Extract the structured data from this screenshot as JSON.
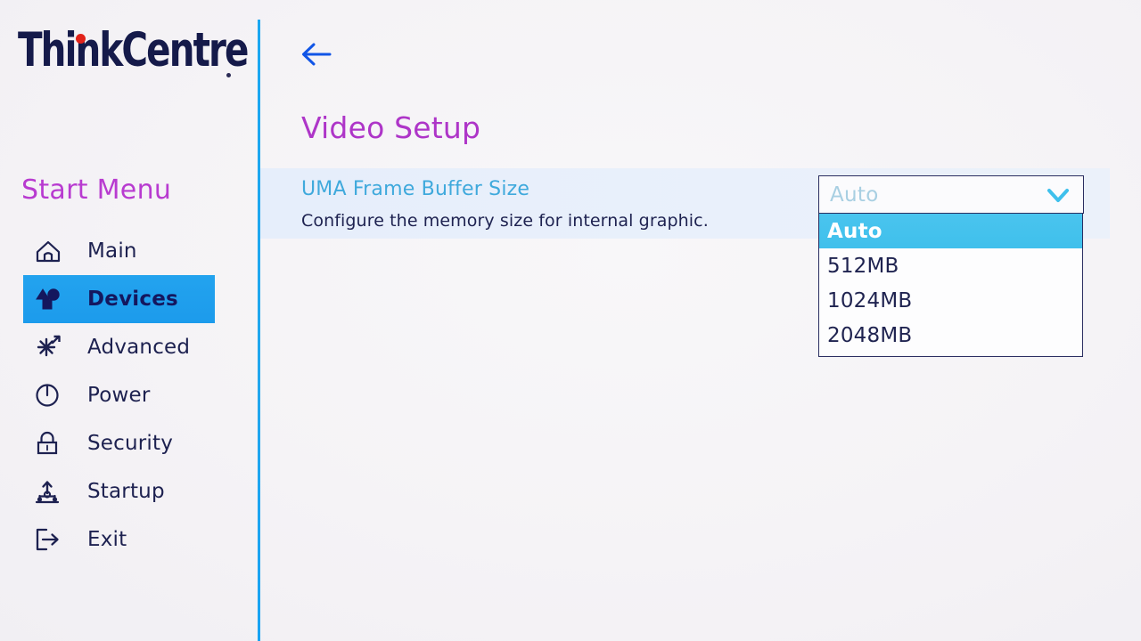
{
  "brand": {
    "logo_text": "ThinkCentre",
    "accent_dot_color": "#E2231A",
    "logo_color": "#151A4A"
  },
  "sidebar": {
    "title": "Start Menu",
    "title_color": "#B83BD0",
    "selected_color": "#1C9BEC",
    "items": [
      {
        "label": "Main",
        "icon": "home-icon",
        "selected": false
      },
      {
        "label": "Devices",
        "icon": "devices-icon",
        "selected": true
      },
      {
        "label": "Advanced",
        "icon": "advanced-icon",
        "selected": false
      },
      {
        "label": "Power",
        "icon": "power-icon",
        "selected": false
      },
      {
        "label": "Security",
        "icon": "lock-icon",
        "selected": false
      },
      {
        "label": "Startup",
        "icon": "startup-icon",
        "selected": false
      },
      {
        "label": "Exit",
        "icon": "exit-icon",
        "selected": false
      }
    ]
  },
  "main": {
    "back_icon": "back-arrow-icon",
    "title": "Video Setup",
    "title_color": "#AE35C8",
    "setting": {
      "label": "UMA Frame Buffer Size",
      "label_color": "#3FA9DC",
      "description": "Configure the memory size for internal graphic."
    },
    "dropdown": {
      "selected_value": "Auto",
      "chevron_icon": "chevron-down-icon",
      "expanded": true,
      "highlight_color": "#3FC0EC",
      "options": [
        {
          "label": "Auto",
          "highlighted": true
        },
        {
          "label": "512MB",
          "highlighted": false
        },
        {
          "label": "1024MB",
          "highlighted": false
        },
        {
          "label": "2048MB",
          "highlighted": false
        }
      ]
    }
  }
}
